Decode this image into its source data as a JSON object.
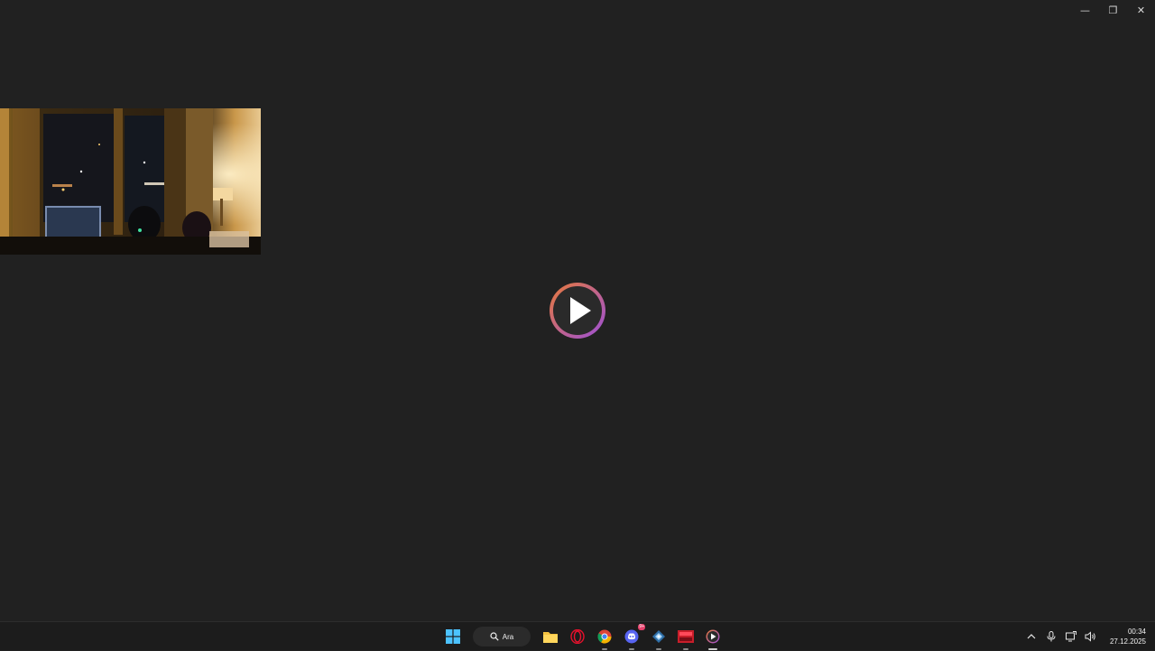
{
  "window": {
    "minimize_glyph": "—",
    "maximize_glyph": "❐",
    "close_glyph": "✕"
  },
  "player": {
    "thumbnail_icon": "video-thumbnail",
    "play_icon": "play-icon"
  },
  "taskbar": {
    "search_label": "Ara",
    "discord_badge": "9+",
    "clock_time": "00:34",
    "clock_date": "27.12.2025",
    "pinned": [
      "windows-start-icon",
      "search-icon",
      "file-explorer-icon",
      "opera-icon",
      "chrome-icon",
      "discord-icon",
      "app-icon",
      "video-editor-icon",
      "media-player-icon"
    ],
    "tray": [
      "chevron-up-icon",
      "microphone-icon",
      "network-icon",
      "volume-icon"
    ]
  },
  "colors": {
    "background": "#212121",
    "taskbar": "#1c1c1c",
    "play_ring_start": "#e87a3a",
    "play_ring_end": "#9b4fd8"
  }
}
